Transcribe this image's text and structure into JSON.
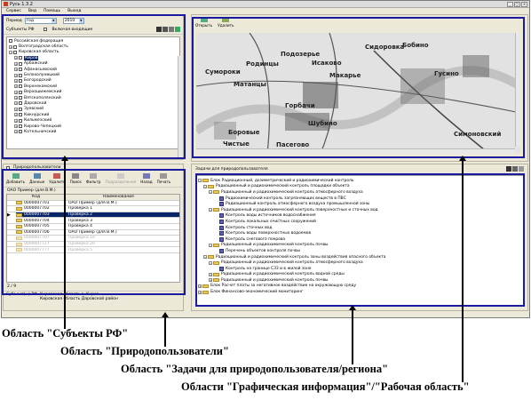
{
  "window": {
    "title": "Русь 1.3.2"
  },
  "menu": [
    "Сервис",
    "Вид",
    "Помощь",
    "Выход"
  ],
  "period": {
    "label": "Период",
    "value": "год",
    "year": "2010"
  },
  "subjects": {
    "header": "Субъекты РФ",
    "include_label": "Включая входящие",
    "items": [
      "Российская федерация",
      "Волгоградская область",
      "Кировская область",
      "Киров",
      "Арбажский",
      "Афанасьевский",
      "Белохолуницкий",
      "Богородский",
      "Верхнекамский",
      "Верхошижемский",
      "Вятскополянский",
      "Даровской",
      "Зуевский",
      "Кикнурский",
      "Кильмезский",
      "Кирово-Чепецкий",
      "Котельничский"
    ]
  },
  "users": {
    "tab_label": "Природопользователи",
    "toolbar": [
      "Добавить",
      "Данные",
      "Удалить",
      "Поиск",
      "Фильтр",
      "Подразделения",
      "Назад",
      "Печать"
    ],
    "crumb": "ОАО Пример (для В.М.)",
    "columns": [
      "Код",
      "Наименование"
    ],
    "rows": [
      {
        "code": "0000007701",
        "name": "ОАО Пример (для В.М.)"
      },
      {
        "code": "0000007702",
        "name": "Проверка 1"
      },
      {
        "code": "0000007703",
        "name": "Проверка 2"
      },
      {
        "code": "0000007704",
        "name": "Проверка 3"
      },
      {
        "code": "0000007705",
        "name": "Проверка 4"
      },
      {
        "code": "0000007706",
        "name": "ОАО Пример (для В.М.)"
      },
      {
        "code": "0000007707",
        "name": "Проверка 10"
      },
      {
        "code": "0000007727",
        "name": "Проверка 20"
      },
      {
        "code": "0000007777",
        "name": "Проверка 5"
      }
    ],
    "counter": "2 / 9",
    "footer_label": "Субъект(ы) РФ",
    "footer_lines": [
      "Кировская область г. Киров",
      "Кировская область Даровской район"
    ]
  },
  "graphic": {
    "toolbar": [
      "Открыть",
      "Удалить"
    ],
    "map_labels": [
      "Родинцы",
      "Подозерье",
      "Исаково",
      "Сумороки",
      "Матанцы",
      "Макарье",
      "Горбачи",
      "Шубино",
      "Боровые",
      "Чистые",
      "Пасегово",
      "Сидоровка",
      "Бобино",
      "Гусино",
      "Симоновский"
    ]
  },
  "tasks": {
    "header": "Задачи для природопользователя",
    "items": [
      {
        "level": 0,
        "kind": "folder",
        "text": "Блок Радиационный, дозиметрический и радиохимический контроль"
      },
      {
        "level": 1,
        "kind": "folder",
        "text": "Радиационный и радиохимический контроль площадки объекта"
      },
      {
        "level": 2,
        "kind": "folder",
        "text": "Радиационный и радиохимический контроль атмосферного воздуха"
      },
      {
        "level": 3,
        "kind": "doc",
        "text": "Радиохимический контроль загрязняющих веществ в ПВС"
      },
      {
        "level": 3,
        "kind": "doc",
        "text": "Радиационный контроль атмосферного воздуха промышленной зоны"
      },
      {
        "level": 2,
        "kind": "folder",
        "text": "Радиационный и радиохимический контроль поверхностных и сточных вод"
      },
      {
        "level": 3,
        "kind": "doc",
        "text": "Контроль воды источников водоснабжения"
      },
      {
        "level": 3,
        "kind": "doc",
        "text": "Контроль локальных очистных сооружений"
      },
      {
        "level": 3,
        "kind": "doc",
        "text": "Контроль сточных вод"
      },
      {
        "level": 3,
        "kind": "doc",
        "text": "Контроль воды поверхностных водоемов"
      },
      {
        "level": 3,
        "kind": "doc",
        "text": "Контроль снегового покрова"
      },
      {
        "level": 2,
        "kind": "folder",
        "text": "Радиационный и радиохимический контроль почвы"
      },
      {
        "level": 3,
        "kind": "doc",
        "text": "Перечень объектов контроля почвы"
      },
      {
        "level": 1,
        "kind": "folder",
        "text": "Радиационный и радиохимический контроль зоны воздействия опасного объекта"
      },
      {
        "level": 2,
        "kind": "folder",
        "text": "Радиационный и радиохимический контроль атмосферного воздуха"
      },
      {
        "level": 3,
        "kind": "doc",
        "text": "Контроль на границе СЗЗ и в жилой зоне"
      },
      {
        "level": 2,
        "kind": "folder",
        "text": "Радиационный и радиохимический контроль водной среды"
      },
      {
        "level": 2,
        "kind": "folder",
        "text": "Радиационный и радиохимический контроль почвы"
      },
      {
        "level": 0,
        "kind": "folder",
        "text": "Блок Расчет платы за негативное воздействие на окружающую среду"
      },
      {
        "level": 0,
        "kind": "folder",
        "text": "Блок Финансово-экономический мониторинг"
      }
    ]
  },
  "captions": [
    "Область \"Субъекты РФ\"",
    "Область \"Природопользователи\"",
    "Область \"Задачи для природопользователя/региона\"",
    "Области \"Графическая информация\"/\"Рабочая область\""
  ],
  "colors": {
    "selection_border": "#1a1aa0",
    "row_highlight": "#0a246a",
    "folder": "#e8c860"
  }
}
